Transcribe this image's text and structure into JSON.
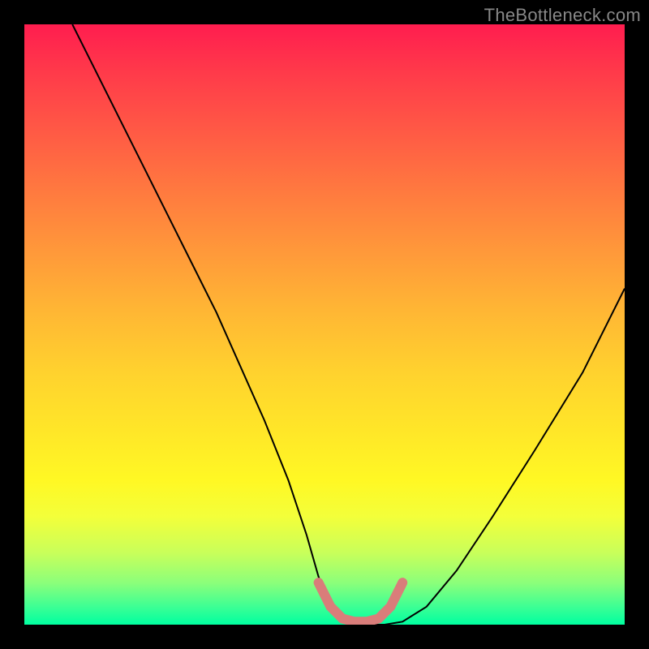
{
  "watermark": "TheBottleneck.com",
  "chart_data": {
    "type": "line",
    "title": "",
    "xlabel": "",
    "ylabel": "",
    "xlim": [
      0,
      100
    ],
    "ylim": [
      0,
      100
    ],
    "gradient_colors": {
      "top": "#ff1d4f",
      "mid": "#ffe728",
      "bottom": "#00ffa0"
    },
    "series": [
      {
        "name": "black-curve",
        "color": "#000000",
        "x": [
          8,
          12,
          16,
          20,
          24,
          28,
          32,
          36,
          40,
          44,
          47,
          49,
          51,
          54,
          57,
          60,
          63,
          67,
          72,
          78,
          85,
          93,
          100
        ],
        "y": [
          100,
          92,
          84,
          76,
          68,
          60,
          52,
          43,
          34,
          24,
          15,
          8,
          3,
          0.5,
          0,
          0,
          0.5,
          3,
          9,
          18,
          29,
          42,
          56
        ]
      },
      {
        "name": "pink-basin",
        "color": "#d97d7a",
        "x": [
          49,
          51,
          53,
          55,
          57,
          59,
          61,
          63
        ],
        "y": [
          7,
          3,
          1,
          0.5,
          0.5,
          1,
          3,
          7
        ]
      }
    ]
  }
}
